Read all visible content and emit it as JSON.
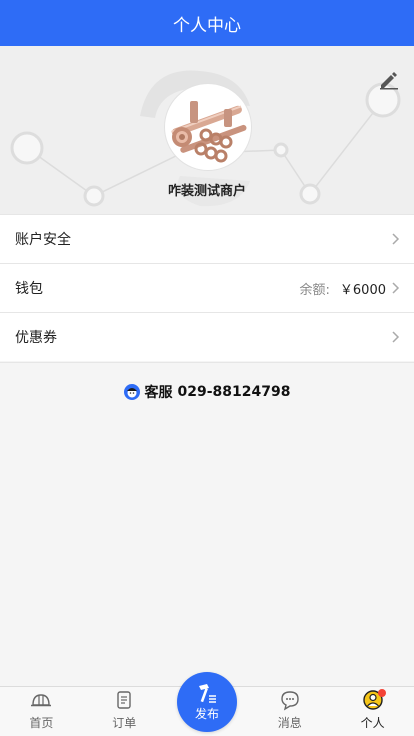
{
  "header": {
    "title": "个人中心"
  },
  "profile": {
    "shop_name": "咋装测试商户"
  },
  "menu": {
    "account_security": "账户安全",
    "wallet": "钱包",
    "balance_label": "余额:",
    "balance_value": "￥6000",
    "coupons": "优惠券"
  },
  "service": {
    "label": "客服",
    "phone": "029-88124798"
  },
  "tabbar": {
    "home": "首页",
    "orders": "订单",
    "publish": "发布",
    "messages": "消息",
    "personal": "个人"
  },
  "colors": {
    "primary": "#2e6cf6",
    "badge": "#f44336"
  }
}
